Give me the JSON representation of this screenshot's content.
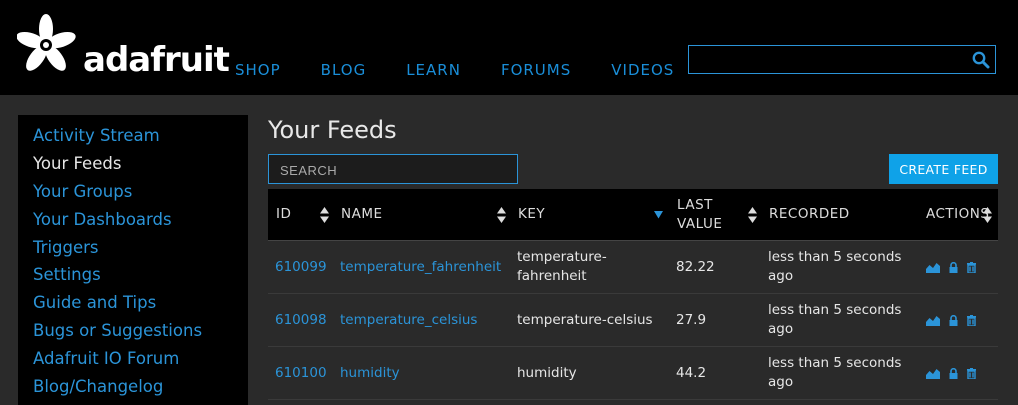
{
  "brand": {
    "name": "adafruit",
    "accent": "#2b94d8",
    "button_color": "#0fa2e8"
  },
  "nav": [
    "SHOP",
    "BLOG",
    "LEARN",
    "FORUMS",
    "VIDEOS"
  ],
  "top_search": {
    "value": "",
    "icon": "search-icon"
  },
  "sidebar": {
    "items": [
      {
        "label": "Activity Stream",
        "active": false
      },
      {
        "label": "Your Feeds",
        "active": true
      },
      {
        "label": "Your Groups",
        "active": false
      },
      {
        "label": "Your Dashboards",
        "active": false
      },
      {
        "label": "Triggers",
        "active": false
      },
      {
        "label": "Settings",
        "active": false
      },
      {
        "label": "Guide and Tips",
        "active": false
      },
      {
        "label": "Bugs or Suggestions",
        "active": false
      },
      {
        "label": "Adafruit IO Forum",
        "active": false
      },
      {
        "label": "Blog/Changelog",
        "active": false
      }
    ]
  },
  "main": {
    "title": "Your Feeds",
    "search_placeholder": "SEARCH",
    "create_label": "CREATE FEED",
    "columns": [
      {
        "label": "ID",
        "sort": "both"
      },
      {
        "label": "NAME",
        "sort": "both"
      },
      {
        "label": "KEY",
        "sort": "desc"
      },
      {
        "label": "LAST VALUE",
        "sort": "both"
      },
      {
        "label": "RECORDED",
        "sort": "none"
      },
      {
        "label": "ACTIONS",
        "sort": "both"
      }
    ],
    "rows": [
      {
        "id": "610099",
        "name": "temperature_fahrenheit",
        "key": "temperature-fahrenheit",
        "last_value": "82.22",
        "recorded": "less than 5 seconds ago"
      },
      {
        "id": "610098",
        "name": "temperature_celsius",
        "key": "temperature-celsius",
        "last_value": "27.9",
        "recorded": "less than 5 seconds ago"
      },
      {
        "id": "610100",
        "name": "humidity",
        "key": "humidity",
        "last_value": "44.2",
        "recorded": "less than 5 seconds ago"
      }
    ],
    "action_icons": [
      "chart-icon",
      "lock-icon",
      "trash-icon"
    ]
  }
}
